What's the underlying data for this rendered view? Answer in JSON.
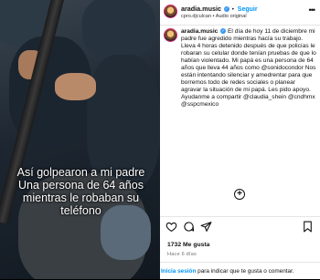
{
  "video": {
    "caption": "Así golpearon a mi padre Una persona de 64 años mientras le robaban su teléfono"
  },
  "header": {
    "username": "aradia.music",
    "follow_label": "Seguir",
    "subtitle": "cpro.djculcan • Audio original"
  },
  "post": {
    "username": "aradia.music",
    "text": "El día de hoy 11 de diciembre mi padre fue agredido mientras hacía su trabajo. Lleva 4 horas detenido después de que policías le robaran su celular donde tenían pruebas de que lo habían violentado. Mi papá es una persona de 64 años que lleva 44 años como @sonidocondor Nos están intentando silenciar y amedrentar para que borremos todo de redes sociales o planear agravar la situación de mi papá. Les pido apoyo. Ayudanme a compartir @claudia_shein @cndhmx @sspcmexico"
  },
  "stats": {
    "likes": "1732 Me gusta",
    "date": "Hace 6 días"
  },
  "login_bar": {
    "link_label": "Inicia sesión",
    "text": "para indicar que te gusta o comentar."
  },
  "colors": {
    "link": "#0095f6",
    "verified": "#3897f0",
    "text": "#111111",
    "muted": "#737373"
  },
  "icons": [
    "more-icon",
    "verified-icon",
    "add-comment-icon",
    "heart-icon",
    "comment-icon",
    "share-icon",
    "bookmark-icon"
  ]
}
